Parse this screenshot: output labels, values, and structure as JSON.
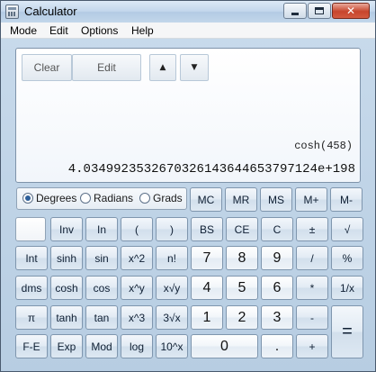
{
  "window": {
    "title": "Calculator"
  },
  "menu": {
    "items": [
      "Mode",
      "Edit",
      "Options",
      "Help"
    ]
  },
  "display": {
    "clear_label": "Clear",
    "edit_label": "Edit",
    "expression": "cosh(458)",
    "result": "4.0349923532670326143644653797124e+198"
  },
  "angle": {
    "degrees": "Degrees",
    "radians": "Radians",
    "grads": "Grads",
    "selected": "Degrees"
  },
  "memory": {
    "mc": "MC",
    "mr": "MR",
    "ms": "MS",
    "mplus": "M+",
    "mminus": "M-"
  },
  "rows": {
    "r1": {
      "inv": "Inv",
      "ln": "In",
      "lparen": "(",
      "rparen": ")",
      "bs": "BS",
      "ce": "CE",
      "c": "C",
      "pm": "±",
      "sqrt": "√"
    },
    "r2": {
      "int": "Int",
      "sinh": "sinh",
      "sin": "sin",
      "x2": "x^2",
      "nfact": "n!",
      "d7": "7",
      "d8": "8",
      "d9": "9",
      "div": "/",
      "pct": "%"
    },
    "r3": {
      "dms": "dms",
      "cosh": "cosh",
      "cos": "cos",
      "xy": "x^y",
      "xroot": "x√y",
      "d4": "4",
      "d5": "5",
      "d6": "6",
      "mul": "*",
      "recip": "1/x"
    },
    "r4": {
      "pi": "π",
      "tanh": "tanh",
      "tan": "tan",
      "x3": "x^3",
      "cbrt": "3√x",
      "d1": "1",
      "d2": "2",
      "d3": "3",
      "sub": "-"
    },
    "r5": {
      "fe": "F-E",
      "exp": "Exp",
      "mod": "Mod",
      "log": "log",
      "tenx": "10^x",
      "d0": "0",
      "dot": ".",
      "add": "+"
    },
    "equals": "="
  }
}
